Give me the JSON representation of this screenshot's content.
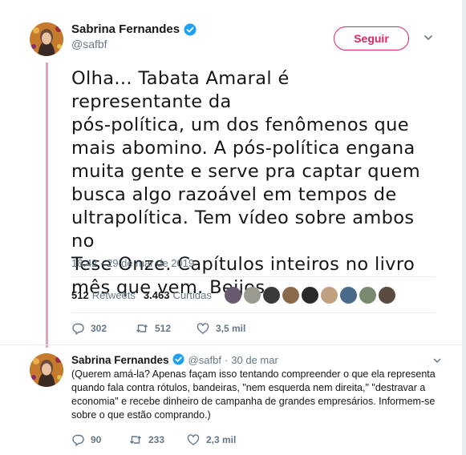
{
  "main_tweet": {
    "author": {
      "name": "Sabrina Fernandes",
      "handle": "@safbf"
    },
    "follow_label": "Seguir",
    "text": "Olha... Tabata Amaral é representante da\npós-política, um dos fenômenos que\nmais abomino. A pós-política engana\nmuita gente e serve pra captar quem\nbusca algo razoável em tempos de\nultrapolítica. Tem vídeo sobre ambos no\nTese Onze. Capítulos inteiros no livro\nmês que vem. Beijos.",
    "timestamp": "18:42 - 29 de mar de 2019",
    "stats": {
      "retweets_count": "512",
      "retweets_label": "Retweets",
      "likes_count": "3.463",
      "likes_label": "Curtidas"
    },
    "actions": {
      "replies": "302",
      "retweets": "512",
      "likes": "3,5 mil"
    }
  },
  "reply_tweet": {
    "author": {
      "name": "Sabrina Fernandes",
      "handle": "@safbf"
    },
    "separator": "·",
    "date": "30 de mar",
    "text": "(Querem amá-la? Apenas façam isso tentando compreender o que ela representa quando fala contra rótulos, bandeiras, \"nem esquerda nem direita,\" \"destravar a economia\" e recebe dinheiro de campanha de grandes empresários. Informem-se sobre o que estão comprando.)",
    "actions": {
      "replies": "90",
      "retweets": "233",
      "likes": "2,3 mil"
    }
  },
  "colors": {
    "accent_pink": "#e0245e",
    "verified_blue": "#1da1f2",
    "muted": "#657786",
    "thread_line": "#e0a4b8"
  },
  "icons": [
    "verified-badge-icon",
    "chevron-down-icon",
    "reply-icon",
    "retweet-icon",
    "like-icon"
  ]
}
